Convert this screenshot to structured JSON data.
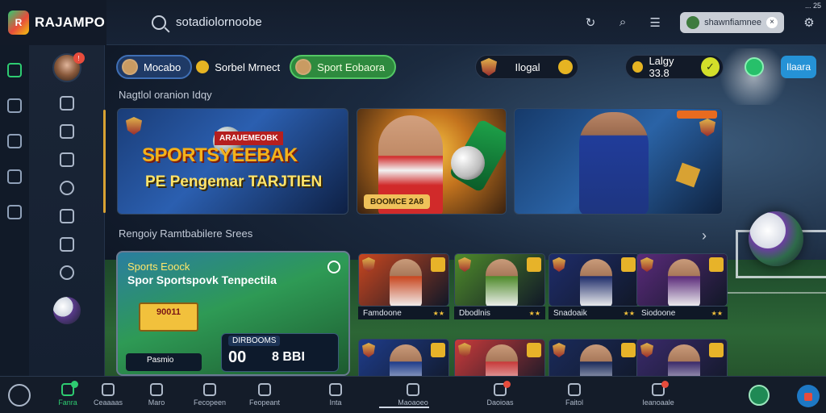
{
  "brand": {
    "name": "RAJAMPO"
  },
  "search": {
    "value": "sotadiolornoobe"
  },
  "top": {
    "account_label": "shawnfiamnee",
    "dots": "... 25"
  },
  "filters": {
    "pill1": "Mocabo",
    "pill2": "Sorbel Mrnect",
    "pill3": "Sport Eobaora",
    "pill4": "Ilogal",
    "pill5": "Lalgy  33.8",
    "button": "Ilaara"
  },
  "sections": {
    "first": "Nagtlol oranion Idqy",
    "second": "Rengoiy Ramtbabilere Srees"
  },
  "banners": {
    "b1_tag": "ARAUEMEOBK",
    "b1_big": "SPORTSYEEBAK",
    "b1_sub": "PE Pengemar TARJTIEN",
    "b2_caption": "BOOMCE 2A8"
  },
  "feature": {
    "line1": "Sports Eoock",
    "line2": "Spor Sportspovk Tenpectila",
    "badge": "90011",
    "score_label": "DIRBOOMS",
    "score_a": "00",
    "score_b": "8 BBI",
    "bottom": "Pasmio"
  },
  "tiles": [
    {
      "label": "Famdoone",
      "color": "#c8461f"
    },
    {
      "label": "Dbodlnis",
      "color": "#4e8a2a"
    },
    {
      "label": "Snadoaik",
      "color": "#1e2c6a"
    },
    {
      "label": "Siodoone",
      "color": "#5a2a7a"
    },
    {
      "label": "",
      "color": "#1e3c8a"
    },
    {
      "label": "",
      "color": "#c83a3a"
    },
    {
      "label": "",
      "color": "#1a2a5a"
    },
    {
      "label": "",
      "color": "#3a2a6a"
    }
  ],
  "bottom_nav": [
    {
      "label": "Fanra",
      "active": true
    },
    {
      "label": "Ceaaaas"
    },
    {
      "label": "Maro"
    },
    {
      "label": "Fecopeen"
    },
    {
      "label": "Feopeant"
    },
    {
      "label": "Inta"
    },
    {
      "label": "Maoaoeo"
    },
    {
      "label": "Daoioas"
    },
    {
      "label": "Faitol"
    },
    {
      "label": "Ieanoaale"
    }
  ],
  "colors": {
    "accent_green": "#2ecc71",
    "accent_gold": "#d8a233",
    "accent_blue": "#2592d6"
  }
}
